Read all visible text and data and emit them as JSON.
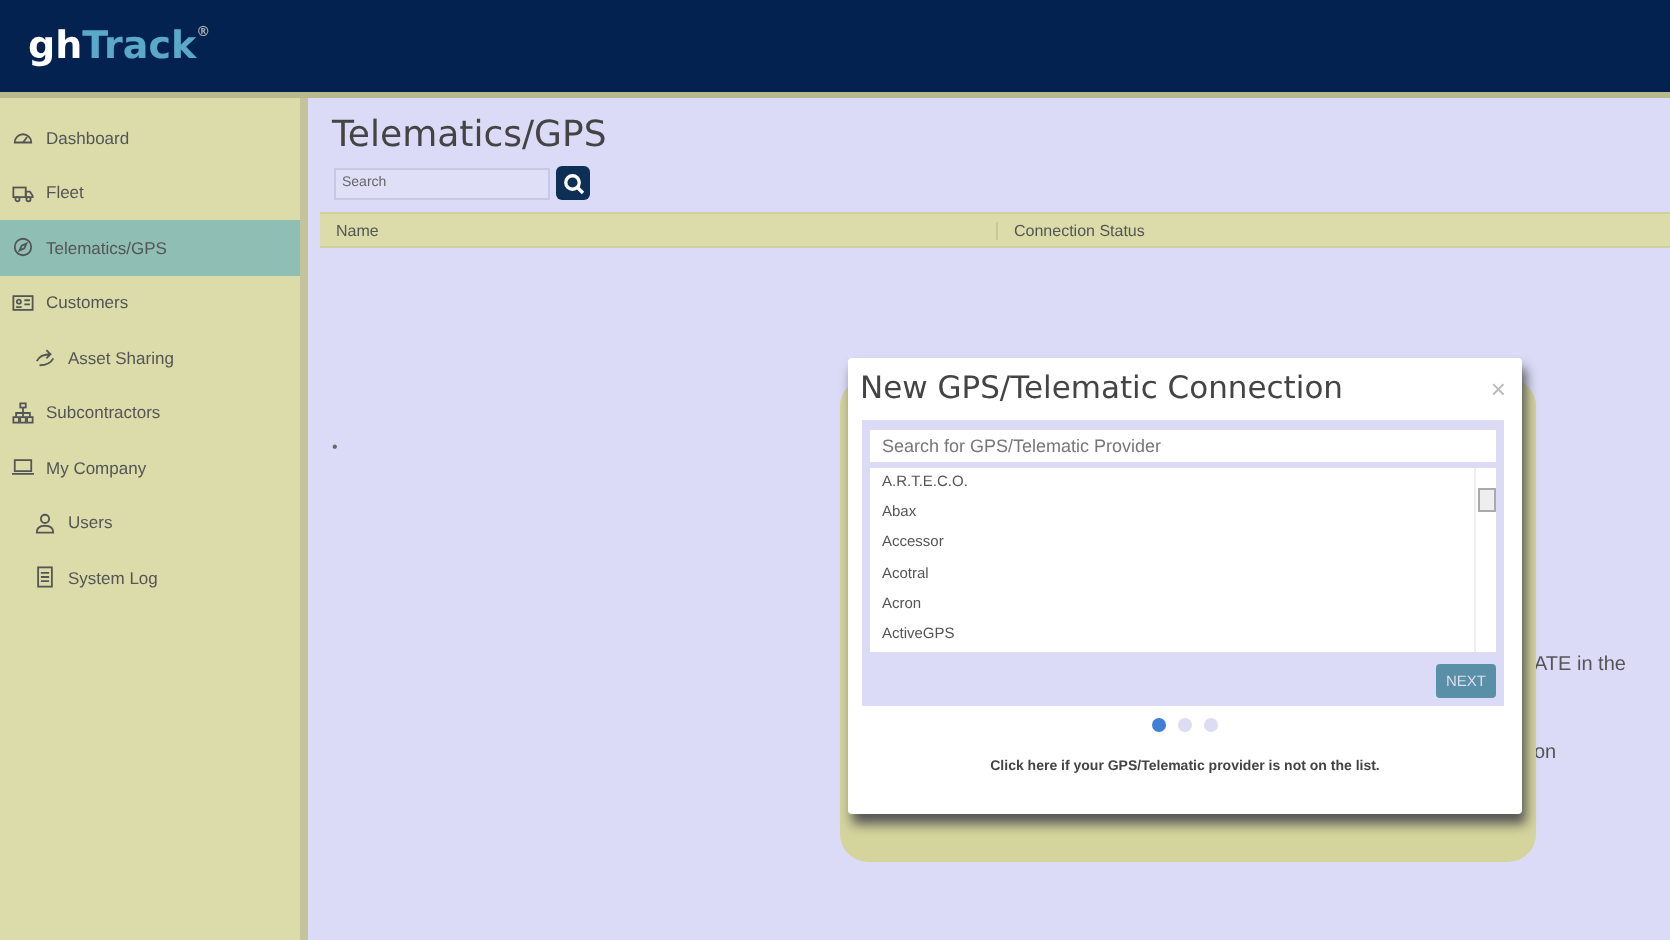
{
  "header": {
    "logo_main": "gh",
    "logo_accent": "Track",
    "logo_mark": "®"
  },
  "sidebar": {
    "items": [
      {
        "label": "Dashboard",
        "selected": false
      },
      {
        "label": "Fleet",
        "selected": false
      },
      {
        "label": "Telematics/GPS",
        "selected": true
      },
      {
        "label": "Customers",
        "selected": false,
        "children": [
          {
            "label": "Asset Sharing",
            "selected": false
          }
        ]
      },
      {
        "label": "Subcontractors",
        "selected": false
      },
      {
        "label": "My Company",
        "selected": false,
        "children": [
          {
            "label": "Users",
            "selected": false
          },
          {
            "label": "System Log",
            "selected": false
          }
        ]
      }
    ]
  },
  "page": {
    "title": "Telematics/GPS",
    "search": {
      "placeholder": "Search"
    },
    "table": {
      "columns": [
        "Name",
        "Connection Status"
      ],
      "marker": "•"
    },
    "background_texts": [
      "ATE in the",
      "on"
    ]
  },
  "dialog": {
    "title": "New GPS/Telematic Connection",
    "close": "×",
    "search": {
      "placeholder": "Search for GPS/Telematic Provider"
    },
    "providers": [
      "A.R.T.E.C.O.",
      "Abax",
      "Accessor",
      "Acotral",
      "Acron",
      "ActiveGPS"
    ],
    "next_button": "NEXT",
    "steps": [
      {
        "selected": true
      },
      {
        "selected": false
      },
      {
        "selected": false
      }
    ],
    "footer_link": "Click here if your GPS/Telematic provider is not on the list."
  }
}
